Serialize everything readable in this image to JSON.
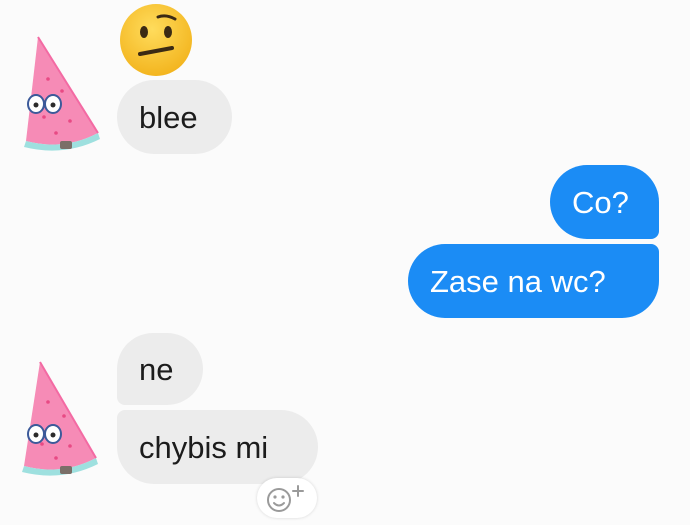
{
  "messages": {
    "incoming_1": "blee",
    "outgoing_1": "Co?",
    "outgoing_2": "Zase na wc?",
    "incoming_2": "ne",
    "incoming_3": "chybis mi"
  },
  "icons": {
    "sticker": "confused-face-emoji",
    "avatar": "watermelon-character-avatar",
    "reaction": "smiley-plus-icon"
  },
  "colors": {
    "outgoing_bubble": "#1b8cf5",
    "incoming_bubble": "#ececec",
    "background": "#fbfbfb"
  }
}
